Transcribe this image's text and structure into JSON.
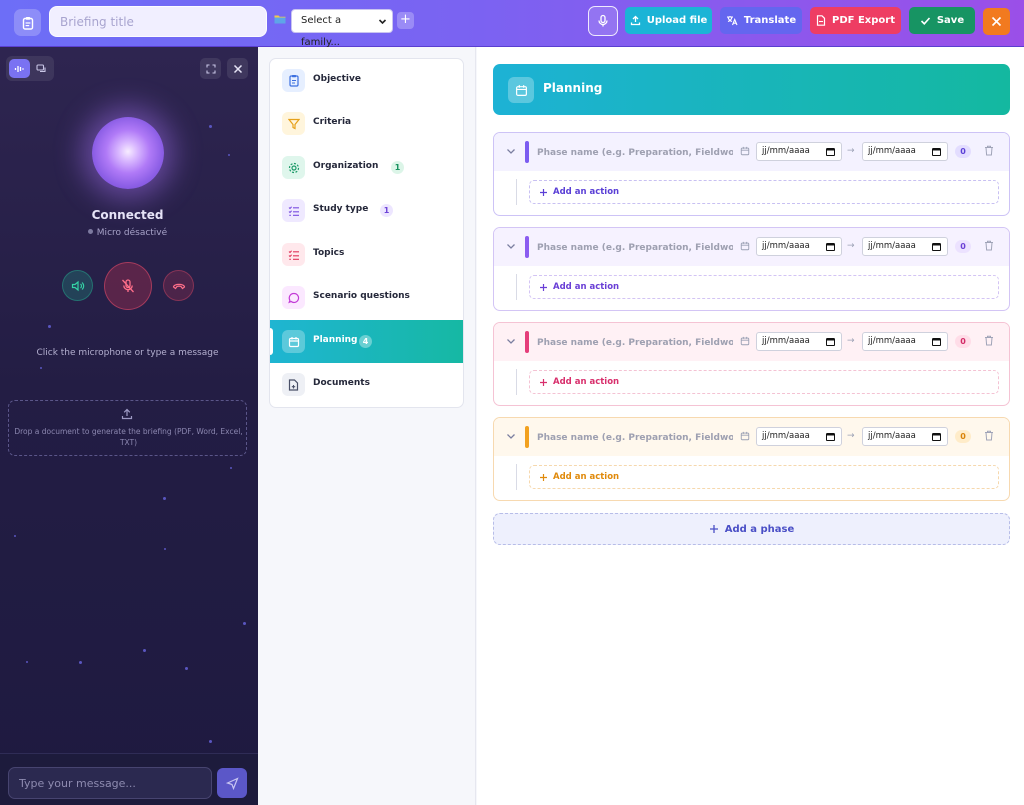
{
  "topbar": {
    "title_placeholder": "Briefing title",
    "family_select": "Select a family...",
    "add_label": "+",
    "upload_label": "Upload file",
    "translate_label": "Translate",
    "pdf_label": "PDF Export",
    "save_label": "Save",
    "colors": {
      "upload": "#1bb4d6",
      "translate": "#6466ef",
      "pdf": "#ee3d63",
      "save": "#179463",
      "close": "#f27a1f"
    }
  },
  "voice": {
    "status": "Connected",
    "mic_status": "Micro désactivé",
    "hint": "Click the microphone or type a message",
    "drop_text": "Drop a document to generate the briefing (PDF, Word, Excel, TXT)",
    "message_placeholder": "Type your message..."
  },
  "nav": {
    "items": [
      {
        "label": "Objective",
        "icon": "clipboard-icon"
      },
      {
        "label": "Criteria",
        "icon": "filter-icon"
      },
      {
        "label": "Organization",
        "icon": "gear-icon",
        "count": "1"
      },
      {
        "label": "Study type",
        "icon": "checklist-icon",
        "count": "1"
      },
      {
        "label": "Topics",
        "icon": "list-icon"
      },
      {
        "label": "Scenario questions",
        "icon": "chat-bubble-icon"
      },
      {
        "label": "Planning",
        "icon": "calendar-icon",
        "count": "4",
        "active": true
      },
      {
        "label": "Documents",
        "icon": "document-icon"
      }
    ]
  },
  "main": {
    "title": "Planning",
    "phase_placeholder": "Phase name (e.g. Preparation, Fieldwork, Analysis...)",
    "date_placeholder": "jj/mm/aaaa",
    "date_arrow": "→",
    "add_action_label": "Add an action",
    "add_phase_label": "Add a phase",
    "phases": [
      {
        "count": "0",
        "color": "#7b5cf0"
      },
      {
        "count": "0",
        "color": "#8b5cf0"
      },
      {
        "count": "0",
        "color": "#e53e7a"
      },
      {
        "count": "0",
        "color": "#f2a11f"
      }
    ]
  }
}
